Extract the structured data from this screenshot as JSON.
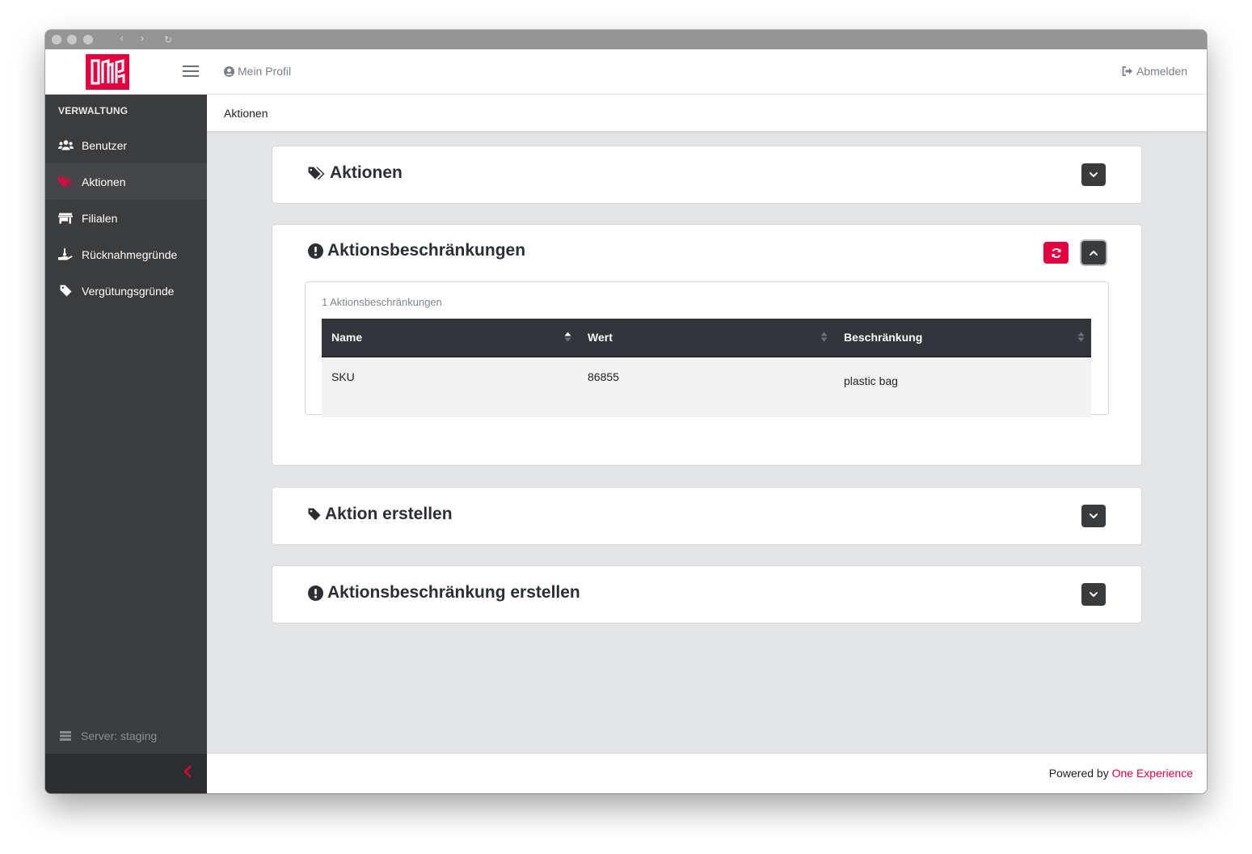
{
  "topbar": {
    "profile_label": "Mein Profil",
    "logout_label": "Abmelden"
  },
  "sidebar": {
    "heading": "VERWALTUNG",
    "items": [
      {
        "label": "Benutzer",
        "icon": "users-icon",
        "active": false
      },
      {
        "label": "Aktionen",
        "icon": "tags-icon",
        "active": true
      },
      {
        "label": "Filialen",
        "icon": "store-icon",
        "active": false
      },
      {
        "label": "Rücknahmegründe",
        "icon": "hand-holding-icon",
        "active": false
      },
      {
        "label": "Vergütungsgründe",
        "icon": "tag-icon",
        "active": false
      }
    ],
    "server_status": "Server: staging"
  },
  "breadcrumb": "Aktionen",
  "sections": {
    "aktionen": {
      "title": "Aktionen"
    },
    "beschraenkungen": {
      "title": "Aktionsbeschränkungen",
      "result_count": "1 Aktionsbeschränkungen",
      "columns": [
        "Name",
        "Wert",
        "Beschränkung"
      ],
      "rows": [
        {
          "name": "SKU",
          "wert": "86855",
          "beschraenkung": "plastic bag"
        }
      ]
    },
    "aktion_erstellen": {
      "title": "Aktion erstellen"
    },
    "beschraenkung_erstellen": {
      "title": "Aktionsbeschränkung erstellen"
    }
  },
  "footer": {
    "powered_prefix": "Powered by",
    "powered_link": "One Experience"
  },
  "colors": {
    "accent": "#e3003f",
    "sidebar_bg": "#3b3c3e",
    "table_header_bg": "#323539"
  }
}
